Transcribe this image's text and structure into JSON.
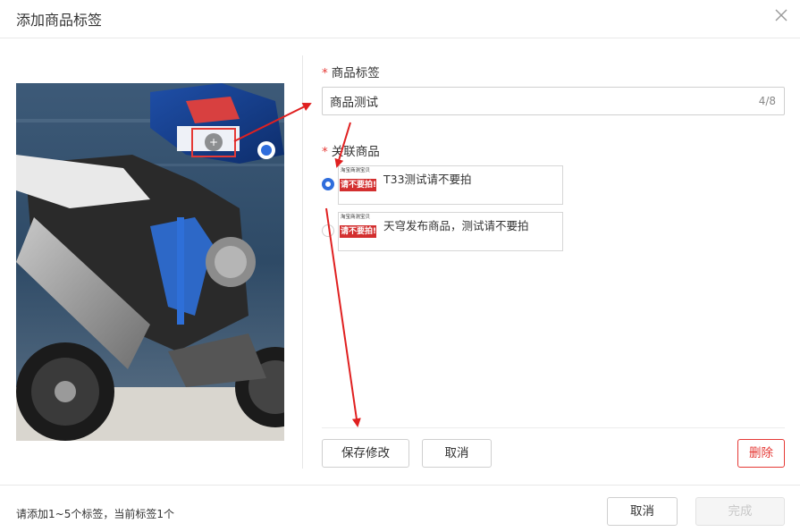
{
  "dialog": {
    "title": "添加商品标签"
  },
  "tag_field": {
    "label": "商品标签",
    "required_mark": "*",
    "value": "商品测试",
    "counter": "4/8"
  },
  "product_field": {
    "label": "关联商品",
    "required_mark": "*",
    "products": [
      {
        "name": "T33测试请不要拍",
        "thumb_top": "淘宝商测宝贝",
        "thumb_banner": "请不要拍!",
        "selected": true
      },
      {
        "name": "天穹发布商品，测试请不要拍",
        "thumb_top": "淘宝商测宝贝",
        "thumb_banner": "请不要拍!",
        "selected": false
      }
    ]
  },
  "image": {
    "tag_marker_symbol": "+"
  },
  "actions": {
    "save_label": "保存修改",
    "cancel_label": "取消",
    "delete_label": "删除"
  },
  "footer": {
    "hint": "请添加1~5个标签，当前标签1个",
    "cancel_label": "取消",
    "done_label": "完成"
  },
  "colors": {
    "accent": "#2f6ddc",
    "danger": "#e53935",
    "annotation": "#e02020"
  },
  "icons": {
    "close": "close-icon"
  }
}
